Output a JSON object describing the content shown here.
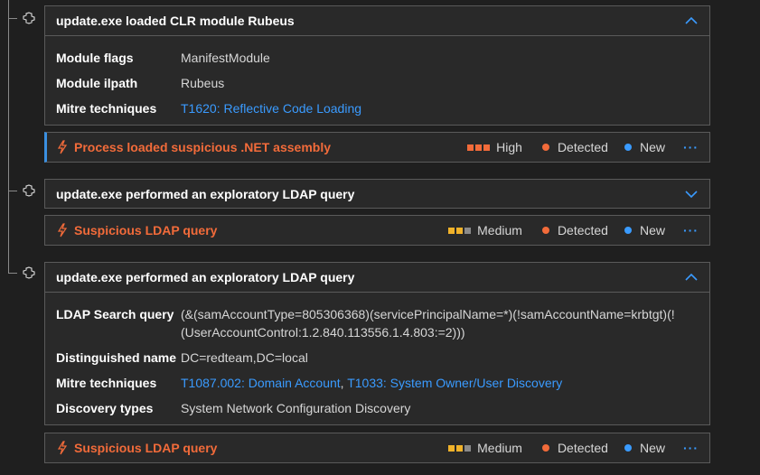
{
  "cards": [
    {
      "title": "update.exe loaded CLR module Rubeus",
      "expanded": true,
      "rows": [
        {
          "key": "Module flags",
          "value": "ManifestModule"
        },
        {
          "key": "Module ilpath",
          "value": "Rubeus"
        },
        {
          "key": "Mitre techniques",
          "links": [
            "T1620: Reflective Code Loading"
          ]
        }
      ]
    },
    {
      "title": "update.exe performed an exploratory LDAP query",
      "expanded": false
    },
    {
      "title": "update.exe performed an exploratory LDAP query",
      "expanded": true,
      "rows": [
        {
          "key": "LDAP Search query",
          "value_lines": [
            "(&(samAccountType=805306368)(servicePrincipalName=*)(!samAccountName=krbtgt)(!",
            "(UserAccountControl:1.2.840.113556.1.4.803:=2)))"
          ]
        },
        {
          "key": "Distinguished name",
          "value": "DC=redteam,DC=local"
        },
        {
          "key": "Mitre techniques",
          "links": [
            "T1087.002: Domain Account",
            "T1033: System Owner/User Discovery"
          ],
          "link_separator": ", "
        },
        {
          "key": "Discovery types",
          "value": "System Network Configuration Discovery"
        }
      ]
    }
  ],
  "alerts": [
    {
      "title": "Process loaded suspicious .NET assembly",
      "severity": "High",
      "severity_level": 3,
      "status": "Detected",
      "classification": "New",
      "more": "···"
    },
    {
      "title": "Suspicious LDAP query",
      "severity": "Medium",
      "severity_level": 2,
      "status": "Detected",
      "classification": "New",
      "more": "···"
    },
    {
      "title": "Suspicious LDAP query",
      "severity": "Medium",
      "severity_level": 2,
      "status": "Detected",
      "classification": "New",
      "more": "···"
    }
  ],
  "colors": {
    "severity_active": "#f26b3a",
    "severity_medium": "#f0b22a",
    "severity_inactive": "#8a8a8a",
    "status_detected": "#f26b3a",
    "status_new": "#3a9bff",
    "link": "#3a9bff"
  },
  "icons": {
    "node": "process-node-icon",
    "alert": "lightning-icon",
    "expand": "chevron-up-icon",
    "collapse": "chevron-down-icon"
  }
}
